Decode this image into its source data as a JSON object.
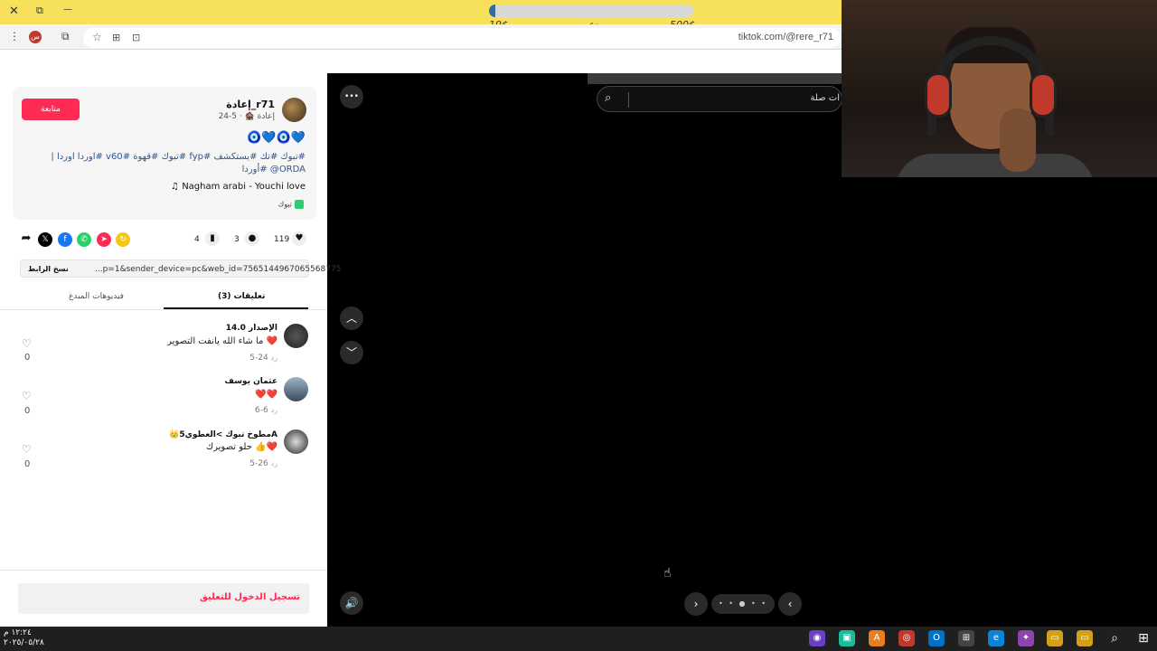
{
  "stream_bar": {
    "close_label": "✕",
    "restore_label": "⧉",
    "minimize_label": "—",
    "donation_min": "19$",
    "donation_label": "دعم",
    "donation_goal": "500$",
    "donation_progress_fraction": 0.03,
    "accent": "#f7e05a"
  },
  "browser": {
    "url": "tiktok.com/@rere_r71"
  },
  "post": {
    "follow_label": "متابعة",
    "author_name": "إعادة_r71",
    "author_meta": "إعادة 🏚️ · 5-24",
    "emoji_line": "🧿💙🧿💙",
    "caption": "#تبوك #تك #يستكشف #fyp #تبوك #قهوة #v60 #اوردا اوردا | ORDA@ #أوردا",
    "music": "♫ Nagham arabi - Youchi love",
    "tag_label": "تبوك"
  },
  "stats": {
    "likes": "119",
    "comments": "3",
    "saves": "4"
  },
  "link": {
    "text": "...p=1&sender_device=pc&web_id=7565144967065568775",
    "copy_label": "نسخ الرابط"
  },
  "tabs": {
    "comments": "(3) تعليقات",
    "creator_videos": "فيديوهات المبدع"
  },
  "comments": [
    {
      "name": "الإصدار 14.0",
      "text": "ما شاء الله يانفت التصوير ❤️",
      "date": "5-24",
      "reply": "رد",
      "likes": "0"
    },
    {
      "name": "عثمان يوسف",
      "text": "❤️❤️",
      "date": "6-6",
      "reply": "رد",
      "likes": "0"
    },
    {
      "name": "👑مطوخ تبوك >العطوي5A",
      "text": "حلو تصويرك 👍❤️",
      "date": "5-26",
      "reply": "رد",
      "likes": "0"
    }
  ],
  "login": {
    "label": "تسجيل الدخول للتعليق"
  },
  "video": {
    "search_placeholder": "ات صلة",
    "more_label": "•••",
    "dots": "• • ● • •"
  },
  "taskbar": {
    "time": "١٢:٢٤ م",
    "date": "٢٠٢٥/٠٥/٢٨"
  }
}
